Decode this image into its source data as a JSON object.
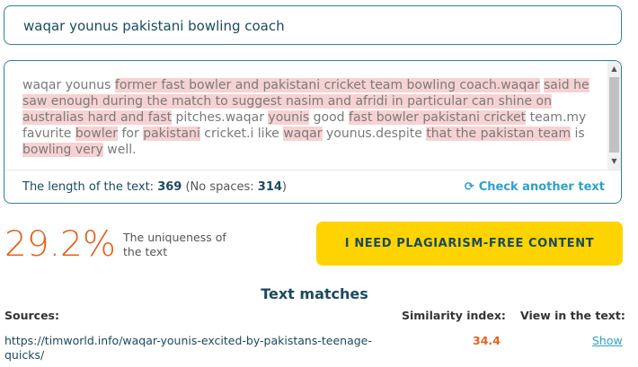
{
  "title": "waqar younus pakistani bowling coach",
  "text_segments": [
    {
      "t": "waqar younus ",
      "hl": false
    },
    {
      "t": "former fast bowler and pakistani cricket team bowling coach.waqar",
      "hl": true
    },
    {
      "t": " ",
      "hl": false
    },
    {
      "t": "said he saw enough during the match to suggest nasim and afridi in particular can shine on australias hard and fast",
      "hl": true
    },
    {
      "t": " pitches.waqar ",
      "hl": false
    },
    {
      "t": "younis",
      "hl": true
    },
    {
      "t": " good ",
      "hl": false
    },
    {
      "t": "fast bowler pakistani cricket",
      "hl": true
    },
    {
      "t": " team.my favurite ",
      "hl": false
    },
    {
      "t": "bowler",
      "hl": true
    },
    {
      "t": " for ",
      "hl": false
    },
    {
      "t": "pakistani",
      "hl": true
    },
    {
      "t": " cricket.i like ",
      "hl": false
    },
    {
      "t": "waqar",
      "hl": true
    },
    {
      "t": " younus.despite ",
      "hl": false
    },
    {
      "t": "that the pakistan team",
      "hl": true
    },
    {
      "t": " is ",
      "hl": false
    },
    {
      "t": "bowling very",
      "hl": true
    },
    {
      "t": " well.",
      "hl": false
    }
  ],
  "stats": {
    "length_label": "The length of the text:",
    "length_value": "369",
    "no_spaces_open": "(No spaces:",
    "no_spaces_value": "314",
    "no_spaces_close": ")"
  },
  "check_another": "Check another text",
  "uniqueness": {
    "percent": "29.2%",
    "label": "The uniqueness of the text"
  },
  "cta_label": "I NEED PLAGIARISM-FREE CONTENT",
  "matches": {
    "title": "Text matches",
    "col_sources": "Sources:",
    "col_similarity": "Similarity index:",
    "col_view": "View in the text:",
    "rows": [
      {
        "url": "https://timworld.info/waqar-younis-excited-by-pakistans-teenage-quicks/",
        "similarity": "34.4",
        "action": "Show"
      }
    ]
  },
  "colors": {
    "border": "#2f7fa8",
    "highlight": "#f7d2d3",
    "accent_orange": "#e2631f",
    "link_blue": "#2ea1c7",
    "cta_yellow": "#fdd400"
  }
}
